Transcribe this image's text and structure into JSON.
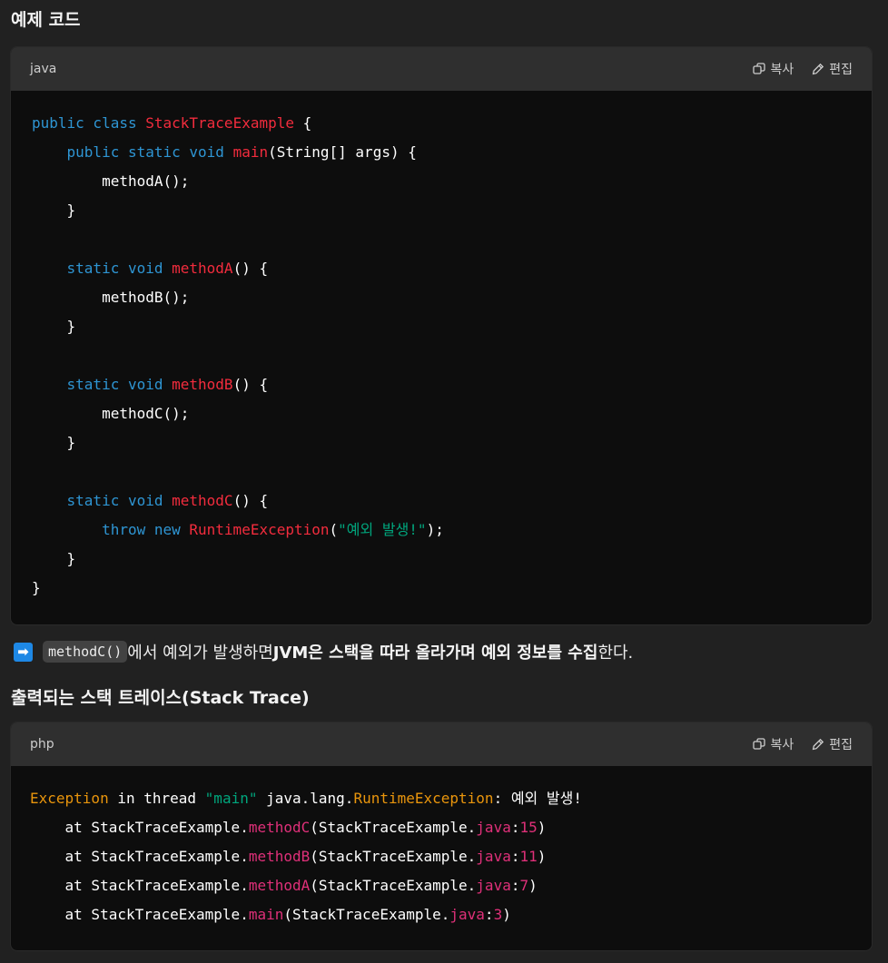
{
  "section1": {
    "heading": "예제 코드"
  },
  "code1": {
    "lang": "java",
    "copy_label": "복사",
    "edit_label": "편집",
    "lines": [
      [
        {
          "c": "kw",
          "t": "public class "
        },
        {
          "c": "cls",
          "t": "StackTraceExample"
        },
        {
          "c": "plain",
          "t": " {"
        }
      ],
      [
        {
          "c": "plain",
          "t": "    "
        },
        {
          "c": "kw",
          "t": "public static void "
        },
        {
          "c": "cls",
          "t": "main"
        },
        {
          "c": "plain",
          "t": "(String[] args) {"
        }
      ],
      [
        {
          "c": "plain",
          "t": "        methodA();"
        }
      ],
      [
        {
          "c": "plain",
          "t": "    }"
        }
      ],
      [
        {
          "c": "plain",
          "t": ""
        }
      ],
      [
        {
          "c": "plain",
          "t": "    "
        },
        {
          "c": "kw",
          "t": "static void "
        },
        {
          "c": "cls",
          "t": "methodA"
        },
        {
          "c": "plain",
          "t": "() {"
        }
      ],
      [
        {
          "c": "plain",
          "t": "        methodB();"
        }
      ],
      [
        {
          "c": "plain",
          "t": "    }"
        }
      ],
      [
        {
          "c": "plain",
          "t": ""
        }
      ],
      [
        {
          "c": "plain",
          "t": "    "
        },
        {
          "c": "kw",
          "t": "static void "
        },
        {
          "c": "cls",
          "t": "methodB"
        },
        {
          "c": "plain",
          "t": "() {"
        }
      ],
      [
        {
          "c": "plain",
          "t": "        methodC();"
        }
      ],
      [
        {
          "c": "plain",
          "t": "    }"
        }
      ],
      [
        {
          "c": "plain",
          "t": ""
        }
      ],
      [
        {
          "c": "plain",
          "t": "    "
        },
        {
          "c": "kw",
          "t": "static void "
        },
        {
          "c": "cls",
          "t": "methodC"
        },
        {
          "c": "plain",
          "t": "() {"
        }
      ],
      [
        {
          "c": "plain",
          "t": "        "
        },
        {
          "c": "kw",
          "t": "throw new "
        },
        {
          "c": "cls",
          "t": "RuntimeException"
        },
        {
          "c": "plain",
          "t": "("
        },
        {
          "c": "str",
          "t": "\"예외 발생!\""
        },
        {
          "c": "plain",
          "t": ");"
        }
      ],
      [
        {
          "c": "plain",
          "t": "    }"
        }
      ],
      [
        {
          "c": "plain",
          "t": "}"
        }
      ]
    ]
  },
  "paragraph": {
    "inline_code": "methodC()",
    "text1": "에서 예외가 발생하면 ",
    "bold1": "JVM은 스택을 따라 올라가며 예외 정보를 수집",
    "text2": "한다."
  },
  "section2": {
    "heading": "출력되는 스택 트레이스(Stack Trace)"
  },
  "code2": {
    "lang": "php",
    "copy_label": "복사",
    "edit_label": "편집",
    "lines": [
      [
        {
          "c": "ex",
          "t": "Exception"
        },
        {
          "c": "plain",
          "t": " in thread "
        },
        {
          "c": "green",
          "t": "\"main\""
        },
        {
          "c": "plain",
          "t": " java.lang."
        },
        {
          "c": "ex",
          "t": "RuntimeException"
        },
        {
          "c": "plain",
          "t": ": 예외 발생!"
        }
      ],
      [
        {
          "c": "plain",
          "t": "    at StackTraceExample."
        },
        {
          "c": "pink",
          "t": "methodC"
        },
        {
          "c": "plain",
          "t": "(StackTraceExample."
        },
        {
          "c": "pink",
          "t": "java"
        },
        {
          "c": "plain",
          "t": ":"
        },
        {
          "c": "pink",
          "t": "15"
        },
        {
          "c": "plain",
          "t": ")"
        }
      ],
      [
        {
          "c": "plain",
          "t": "    at StackTraceExample."
        },
        {
          "c": "pink",
          "t": "methodB"
        },
        {
          "c": "plain",
          "t": "(StackTraceExample."
        },
        {
          "c": "pink",
          "t": "java"
        },
        {
          "c": "plain",
          "t": ":"
        },
        {
          "c": "pink",
          "t": "11"
        },
        {
          "c": "plain",
          "t": ")"
        }
      ],
      [
        {
          "c": "plain",
          "t": "    at StackTraceExample."
        },
        {
          "c": "pink",
          "t": "methodA"
        },
        {
          "c": "plain",
          "t": "(StackTraceExample."
        },
        {
          "c": "pink",
          "t": "java"
        },
        {
          "c": "plain",
          "t": ":"
        },
        {
          "c": "pink",
          "t": "7"
        },
        {
          "c": "plain",
          "t": ")"
        }
      ],
      [
        {
          "c": "plain",
          "t": "    at StackTraceExample."
        },
        {
          "c": "pink",
          "t": "main"
        },
        {
          "c": "plain",
          "t": "(StackTraceExample."
        },
        {
          "c": "pink",
          "t": "java"
        },
        {
          "c": "plain",
          "t": ":"
        },
        {
          "c": "pink",
          "t": "3"
        },
        {
          "c": "plain",
          "t": ")"
        }
      ]
    ]
  }
}
